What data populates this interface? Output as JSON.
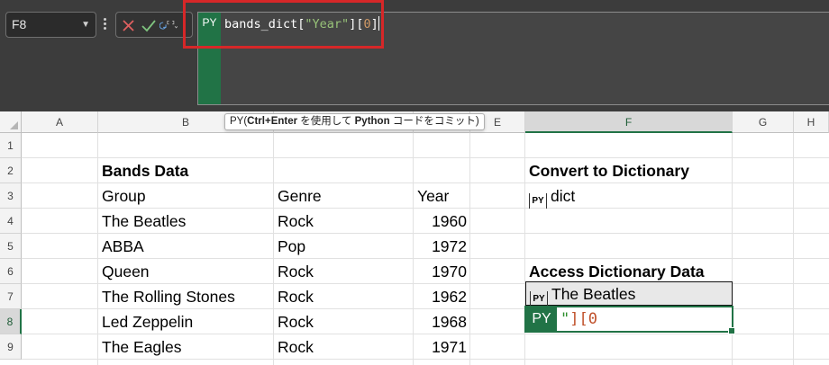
{
  "formula_bar": {
    "name_box": "F8",
    "editor_badge": "PY",
    "code": {
      "prefix": "bands_dict[",
      "string": "\"Year\"",
      "mid": "][",
      "number": "0",
      "suffix": "]"
    }
  },
  "tooltip": {
    "prefix": "PY(",
    "keys": "Ctrl+Enter",
    "mid1": " を使用して ",
    "python": "Python",
    "rest": " コードをコミット)"
  },
  "columns": [
    "A",
    "B",
    "C",
    "D",
    "E",
    "F",
    "G",
    "H"
  ],
  "rows": [
    "1",
    "2",
    "3",
    "4",
    "5",
    "6",
    "7",
    "8",
    "9"
  ],
  "sheet": {
    "title": "Bands Data",
    "headers": {
      "group": "Group",
      "genre": "Genre",
      "year": "Year"
    },
    "bands": [
      {
        "group": "The Beatles",
        "genre": "Rock",
        "year": "1960"
      },
      {
        "group": "ABBA",
        "genre": "Pop",
        "year": "1972"
      },
      {
        "group": "Queen",
        "genre": "Rock",
        "year": "1970"
      },
      {
        "group": "The Rolling Stones",
        "genre": "Rock",
        "year": "1962"
      },
      {
        "group": "Led Zeppelin",
        "genre": "Rock",
        "year": "1968"
      },
      {
        "group": "The Eagles",
        "genre": "Rock",
        "year": "1971"
      }
    ],
    "convert_title": "Convert to Dictionary",
    "py_icon": "PY",
    "dict_value": "dict",
    "access_title": "Access Dictionary Data",
    "access_value": "The Beatles",
    "edit_cell": {
      "badge": "PY",
      "string": "\"",
      "mid": "][",
      "number": "0"
    }
  },
  "colors": {
    "accent": "#217346",
    "highlight_box": "#d62728",
    "formula_bar_bg": "#3c3c3c"
  }
}
